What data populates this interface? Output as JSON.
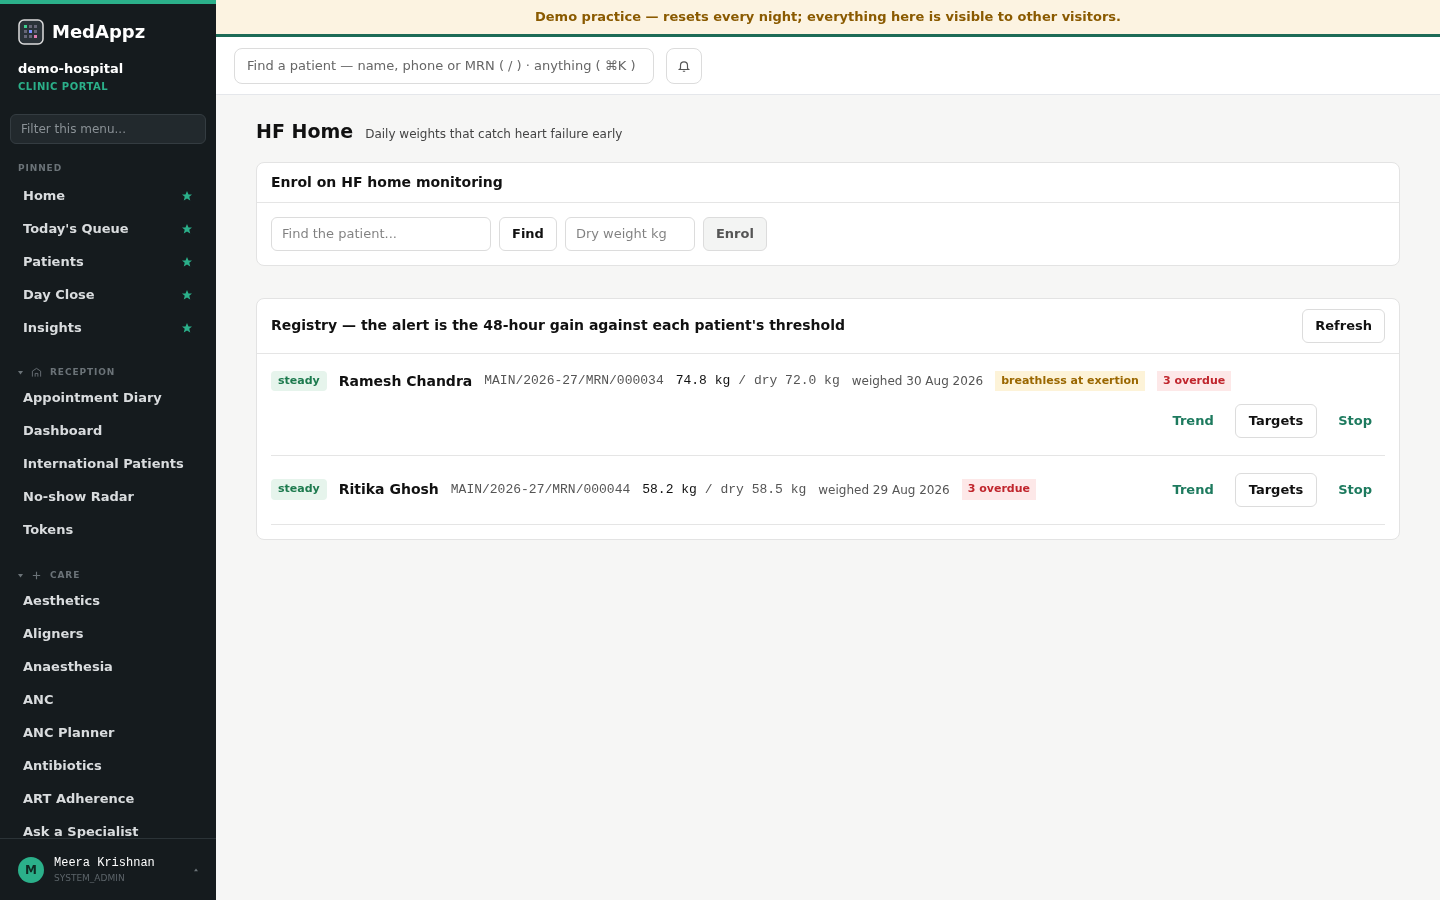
{
  "banner": "Demo practice — resets every night; everything here is visible to other visitors.",
  "sidebar": {
    "brand": "MedAppz",
    "org": "demo-hospital",
    "portal": "CLINIC PORTAL",
    "filter_placeholder": "Filter this menu...",
    "pinned": {
      "title": "PINNED",
      "items": [
        {
          "label": "Home",
          "starred": true
        },
        {
          "label": "Today's Queue",
          "starred": true
        },
        {
          "label": "Patients",
          "starred": true
        },
        {
          "label": "Day Close",
          "starred": true
        },
        {
          "label": "Insights",
          "starred": true
        }
      ]
    },
    "groups": [
      {
        "title": "RECEPTION",
        "kind": "building",
        "expanded": true,
        "items": [
          "Appointment Diary",
          "Dashboard",
          "International Patients",
          "No-show Radar",
          "Tokens"
        ]
      },
      {
        "title": "CARE",
        "kind": "plus",
        "expanded": true,
        "items": [
          "Aesthetics",
          "Aligners",
          "Anaesthesia",
          "ANC",
          "ANC Planner",
          "Antibiotics",
          "ART Adherence",
          "Ask a Specialist"
        ]
      }
    ],
    "user": {
      "initial": "M",
      "name": "Meera Krishnan",
      "role": "SYSTEM_ADMIN"
    }
  },
  "search": {
    "placeholder": "Find a patient — name, phone or MRN ( / ) · anything ( ⌘K )"
  },
  "page": {
    "title": "HF Home",
    "subtitle": "Daily weights that catch heart failure early"
  },
  "enrol": {
    "title": "Enrol on HF home monitoring",
    "patient_placeholder": "Find the patient...",
    "find": "Find",
    "weight_placeholder": "Dry weight kg",
    "enrol": "Enrol"
  },
  "registry": {
    "title": "Registry — the alert is the 48-hour gain against each patient's threshold",
    "refresh": "Refresh",
    "rows": [
      {
        "status": "steady",
        "name": "Ramesh Chandra",
        "mrn": "MAIN/2026-27/MRN/000034",
        "weight": "74.8 kg",
        "dry": "/ dry 72.0 kg",
        "weighed": "weighed 30 Aug 2026",
        "tags": [
          {
            "kind": "note",
            "text": "breathless at exertion"
          },
          {
            "kind": "overdue",
            "text": "3 overdue"
          }
        ],
        "actions": [
          "Trend",
          "Targets",
          "Stop"
        ]
      },
      {
        "status": "steady",
        "name": "Ritika Ghosh",
        "mrn": "MAIN/2026-27/MRN/000044",
        "weight": "58.2 kg",
        "dry": "/ dry 58.5 kg",
        "weighed": "weighed 29 Aug 2026",
        "tags": [
          {
            "kind": "overdue",
            "text": "3 overdue"
          }
        ],
        "actions": [
          "Trend",
          "Targets",
          "Stop"
        ]
      }
    ]
  }
}
